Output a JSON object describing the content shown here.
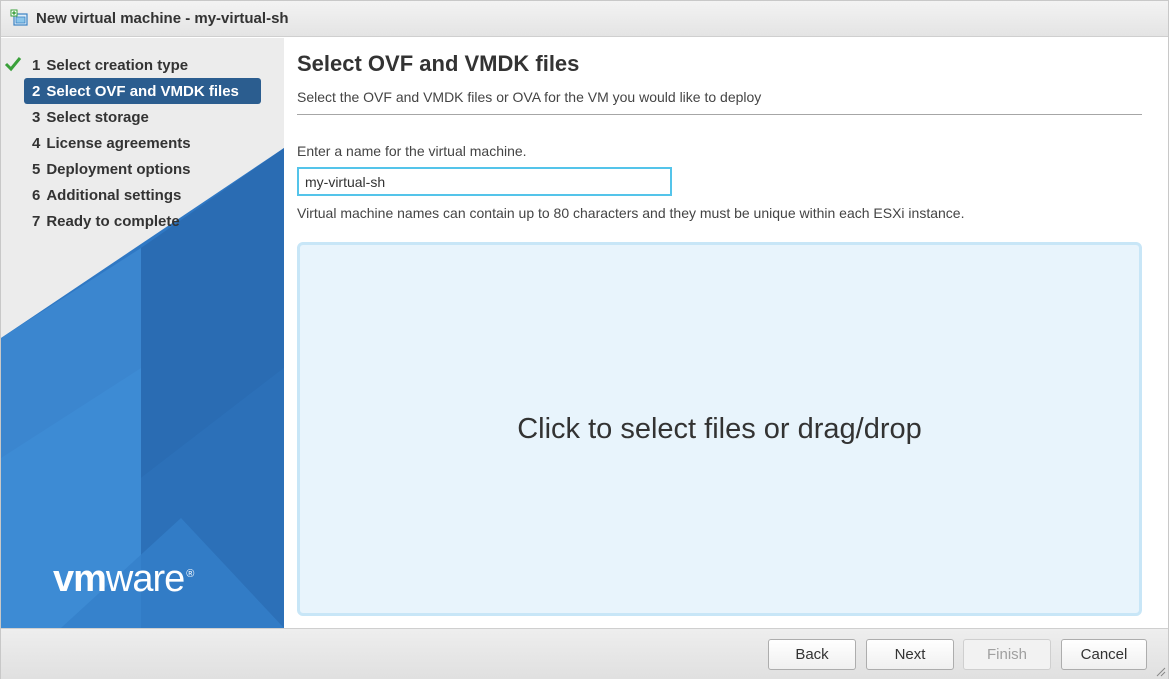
{
  "window": {
    "title": "New virtual machine - my-virtual-sh"
  },
  "sidebar": {
    "steps": [
      {
        "number": "1",
        "label": "Select creation type",
        "completed": true
      },
      {
        "number": "2",
        "label": "Select OVF and VMDK files",
        "active": true
      },
      {
        "number": "3",
        "label": "Select storage"
      },
      {
        "number": "4",
        "label": "License agreements"
      },
      {
        "number": "5",
        "label": "Deployment options"
      },
      {
        "number": "6",
        "label": "Additional settings"
      },
      {
        "number": "7",
        "label": "Ready to complete"
      }
    ],
    "logo_text_vm": "vm",
    "logo_text_ware": "ware",
    "logo_reg": "®"
  },
  "main": {
    "title": "Select OVF and VMDK files",
    "subtitle": "Select the OVF and VMDK files or OVA for the VM you would like to deploy",
    "name_label": "Enter a name for the virtual machine.",
    "name_value": "my-virtual-sh",
    "hint": "Virtual machine names can contain up to 80 characters and they must be unique within each ESXi instance.",
    "dropzone_text": "Click to select files or drag/drop"
  },
  "footer": {
    "back_label": "Back",
    "next_label": "Next",
    "finish_label": "Finish",
    "cancel_label": "Cancel"
  },
  "colors": {
    "active_step_bg": "#2b5d8f",
    "input_border": "#54c4ea",
    "dropzone_bg": "#e8f4fc",
    "sidebar_blue": "#2f78c4",
    "check_green": "#3aa03a"
  },
  "icons": {
    "title_icon": "virtual-machine-icon",
    "completed_icon": "checkmark-icon",
    "resize_icon": "resize-grip-icon"
  }
}
